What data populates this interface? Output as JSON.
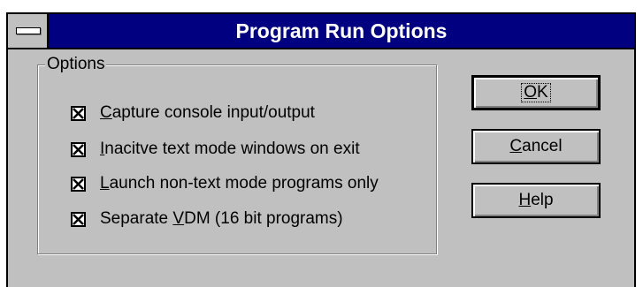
{
  "window": {
    "title": "Program Run Options",
    "system_menu_icon": "system-menu-icon"
  },
  "options_group": {
    "label": "Options",
    "items": [
      {
        "pre": "",
        "key": "C",
        "post": "apture console input/output",
        "checked": true
      },
      {
        "pre": "",
        "key": "I",
        "post": "nacitve text mode windows on exit",
        "checked": true
      },
      {
        "pre": "",
        "key": "L",
        "post": "aunch non-text mode programs only",
        "checked": true
      },
      {
        "pre": "Separate ",
        "key": "V",
        "post": "DM (16 bit programs)",
        "checked": true
      }
    ]
  },
  "buttons": {
    "ok": {
      "pre": "",
      "key": "O",
      "post": "K"
    },
    "cancel": {
      "pre": "",
      "key": "C",
      "post": "ancel"
    },
    "help": {
      "pre": "",
      "key": "H",
      "post": "elp"
    }
  },
  "colors": {
    "titlebar": "#000080",
    "face": "#c0c0c0"
  }
}
